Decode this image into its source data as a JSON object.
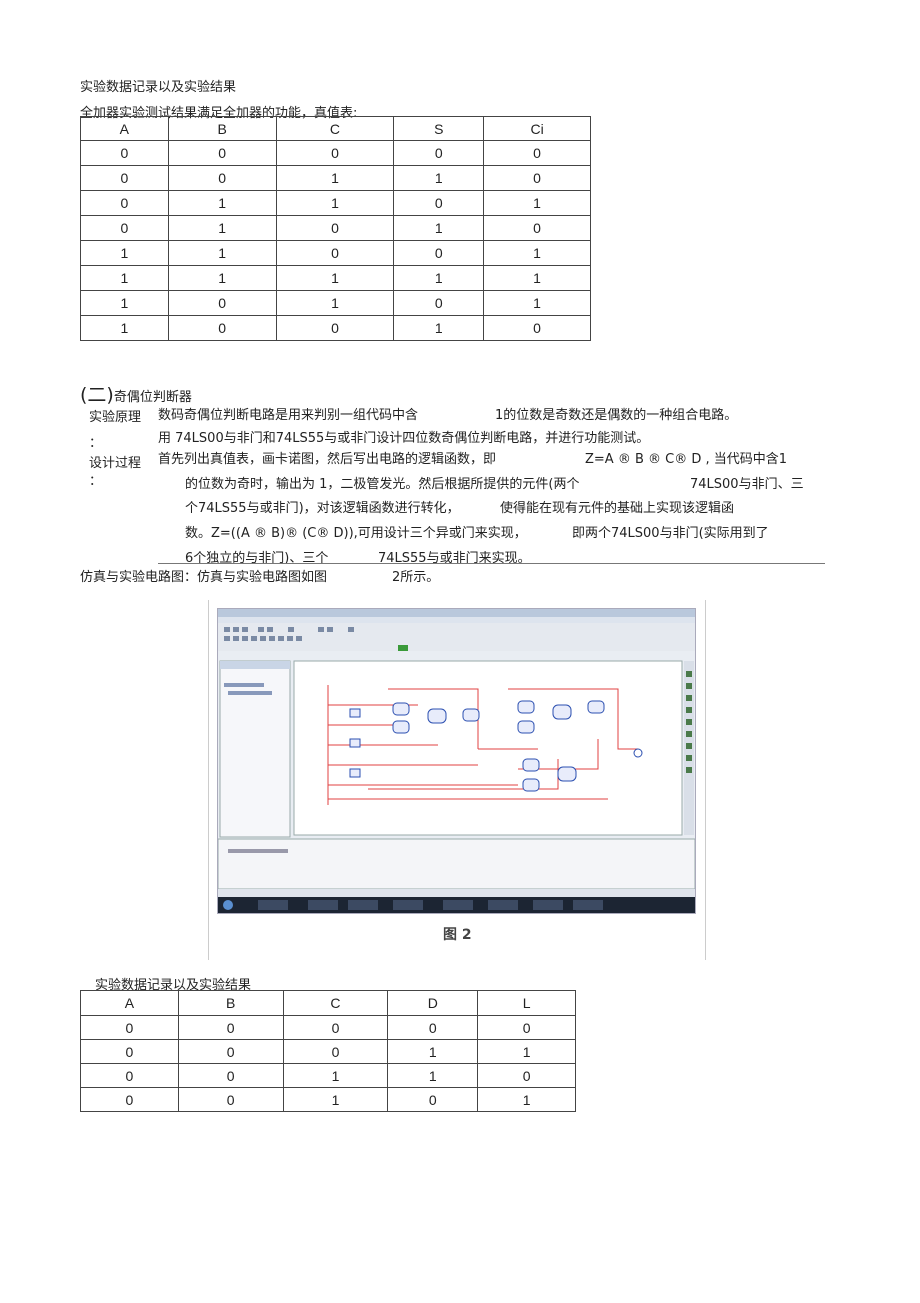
{
  "section1": {
    "heading": "实验数据记录以及实验结果",
    "intro": "全加器实验测试结果满足全加器的功能，真值表:",
    "table": {
      "headers": [
        "A",
        "B",
        "C",
        "S",
        "Ci"
      ],
      "rows": [
        [
          "0",
          "0",
          "0",
          "0",
          "0"
        ],
        [
          "0",
          "0",
          "1",
          "1",
          "0"
        ],
        [
          "0",
          "1",
          "1",
          "0",
          "1"
        ],
        [
          "0",
          "1",
          "0",
          "1",
          "0"
        ],
        [
          "1",
          "1",
          "0",
          "0",
          "1"
        ],
        [
          "1",
          "1",
          "1",
          "1",
          "1"
        ],
        [
          "1",
          "0",
          "1",
          "0",
          "1"
        ],
        [
          "1",
          "0",
          "0",
          "1",
          "0"
        ]
      ]
    }
  },
  "section2": {
    "title_prefix": "(二)",
    "title": "奇偶位判断器",
    "principle_label": "实验原理",
    "colon1": "：",
    "design_label": "设计过程",
    "colon2": "：",
    "p1a": "数码奇偶位判断电路是用来判别一组代码中含",
    "p1b": "1的位数是奇数还是偶数的一种组合电路。",
    "p2": "用  74LS00与非门和74LS55与或非门设计四位数奇偶位判断电路，并进行功能测试。",
    "p3a": "首先列出真值表，画卡诺图，然后写出电路的逻辑函数，即",
    "p3b": "Z=A ® B ® C® D , 当代码中含1",
    "p4a": "的位数为奇时，输出为  1，二极管发光。然后根据所提供的元件(两个",
    "p4b": "74LS00与非门、三",
    "p5a": "个74LS55与或非门)，对该逻辑函数进行转化，",
    "p5b": "使得能在现有元件的基础上实现该逻辑函",
    "p6a": "数。Z=((A ® B)® (C® D)),可用设计三个异或门来实现，",
    "p6b": "即两个74LS00与非门(实际用到了",
    "p7a": "6个独立的与非门)、三个",
    "p7b": "74LS55与或非门来实现。",
    "sim_a": "仿真与实验电路图：仿真与实验电路图如图",
    "sim_b": "2所示。",
    "figure_caption": "图 2"
  },
  "section3": {
    "heading": "实验数据记录以及实验结果",
    "table": {
      "headers": [
        "A",
        "B",
        "C",
        "D",
        "L"
      ],
      "rows": [
        [
          "0",
          "0",
          "0",
          "0",
          "0"
        ],
        [
          "0",
          "0",
          "0",
          "1",
          "1"
        ],
        [
          "0",
          "0",
          "1",
          "1",
          "0"
        ],
        [
          "0",
          "0",
          "1",
          "0",
          "1"
        ]
      ]
    }
  },
  "colors": {
    "wire": "#e04040",
    "gate": "#2b4fb0",
    "taskbar": "#1c2533"
  }
}
